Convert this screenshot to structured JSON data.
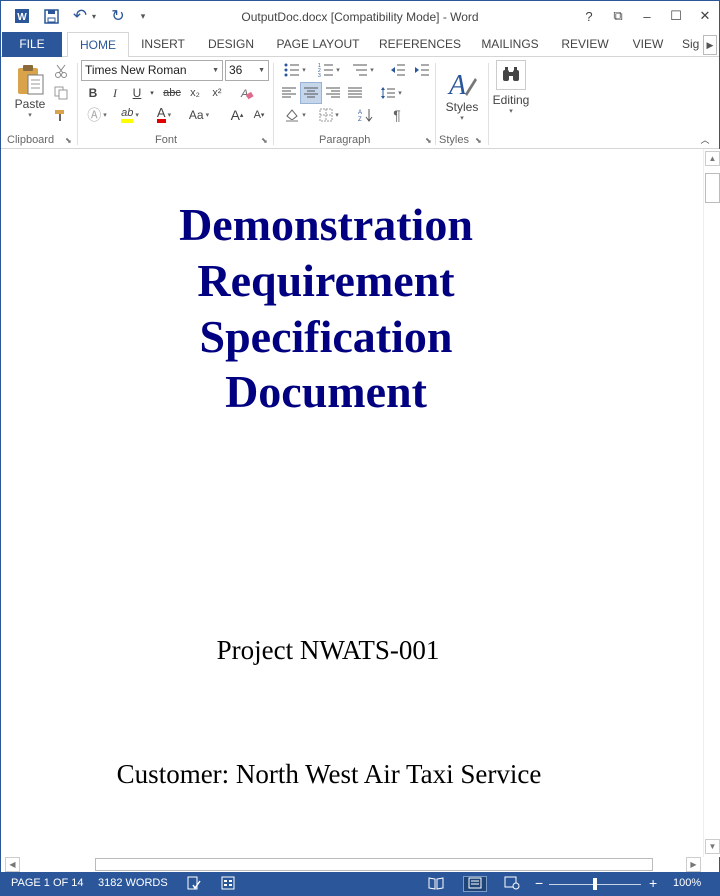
{
  "window": {
    "title": "OutputDoc.docx [Compatibility Mode] - Word",
    "buttons": {
      "help": "?",
      "restore_ribbon": "⧉",
      "minimize": "–",
      "maximize": "☐",
      "close": "✕"
    }
  },
  "qat": {
    "word_icon": "W",
    "save_icon": "save-icon",
    "undo_icon": "↶",
    "redo_icon": "↻",
    "customize": "▾"
  },
  "tabs": [
    "FILE",
    "HOME",
    "INSERT",
    "DESIGN",
    "PAGE LAYOUT",
    "REFERENCES",
    "MAILINGS",
    "REVIEW",
    "VIEW",
    "Sig"
  ],
  "ribbon": {
    "clipboard": {
      "label": "Clipboard",
      "paste": "Paste"
    },
    "font": {
      "label": "Font",
      "name": "Times New Roman",
      "size": "36",
      "bold": "B",
      "italic": "I",
      "underline": "U",
      "strike": "abc",
      "subscript": "x₂",
      "superscript": "x²",
      "highlight": "ab",
      "color": "A",
      "case": "Aa",
      "grow": "A",
      "shrink": "A"
    },
    "paragraph": {
      "label": "Paragraph",
      "pilcrow": "¶"
    },
    "styles": {
      "label": "Styles",
      "button": "Styles"
    },
    "editing": {
      "button": "Editing"
    }
  },
  "document": {
    "title_lines": [
      "Demonstration",
      "Requirement",
      "Specification",
      "Document"
    ],
    "project": "Project NWATS-001",
    "customer": "Customer: North West Air Taxi Service"
  },
  "status": {
    "page": "PAGE 1 OF 14",
    "words": "3182 WORDS",
    "zoom": "100%"
  },
  "colors": {
    "accent": "#2b579a",
    "title_text": "#000080",
    "selected": "#c5d5ea"
  }
}
